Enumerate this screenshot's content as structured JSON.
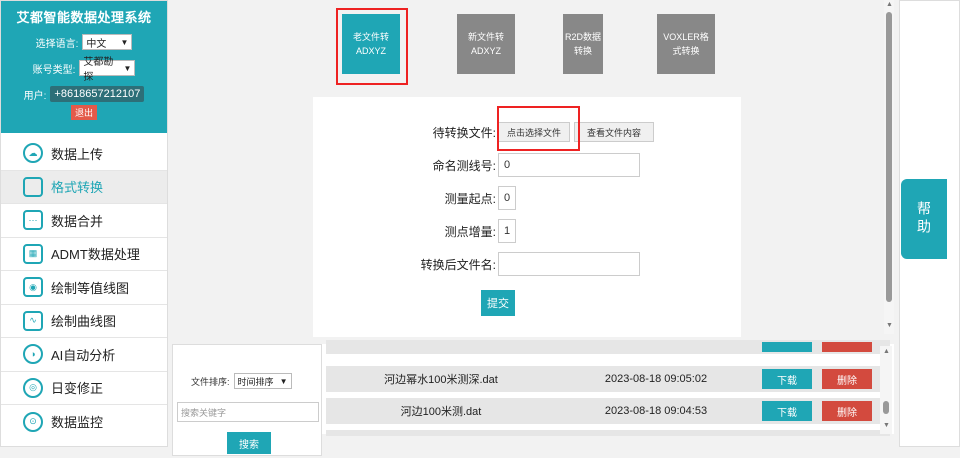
{
  "app_title": "艾都智能数据处理系统",
  "language": {
    "label": "选择语言:",
    "value": "中文"
  },
  "account_type": {
    "label": "账号类型:",
    "value": "艾都勘探"
  },
  "user": {
    "label": "用户:",
    "phone": "+8618657212107",
    "logout": "退出"
  },
  "nav": [
    {
      "label": "数据上传",
      "icon": "cloud-upload-icon"
    },
    {
      "label": "格式转换",
      "icon": "convert-icon"
    },
    {
      "label": "数据合并",
      "icon": "merge-icon"
    },
    {
      "label": "ADMT数据处理",
      "icon": "process-icon"
    },
    {
      "label": "绘制等值线图",
      "icon": "contour-icon"
    },
    {
      "label": "绘制曲线图",
      "icon": "curve-icon"
    },
    {
      "label": "AI自动分析",
      "icon": "ai-icon"
    },
    {
      "label": "日变修正",
      "icon": "correction-icon"
    },
    {
      "label": "数据监控",
      "icon": "monitor-icon"
    }
  ],
  "tools": [
    {
      "label": "老文件转ADXYZ"
    },
    {
      "label": "新文件转ADXYZ"
    },
    {
      "label": "R2D数据转换"
    },
    {
      "label": "VOXLER格式转换"
    }
  ],
  "form": {
    "file_label": "待转换文件:",
    "select_file_btn": "点击选择文件",
    "view_file_btn": "查看文件内容",
    "line_label": "命名测线号:",
    "line_value": "0",
    "start_label": "测量起点:",
    "start_value": "0",
    "step_label": "测点增量:",
    "step_value": "1",
    "outname_label": "转换后文件名:",
    "outname_value": "",
    "submit": "提交"
  },
  "file_panel": {
    "sort_label": "文件排序:",
    "sort_value": "时间排序",
    "search_placeholder": "搜索关键字",
    "search_btn": "搜索"
  },
  "files": [
    {
      "name": "河边幂水100米测深.dat",
      "time": "2023-08-18 09:05:02"
    },
    {
      "name": "河边100米测.dat",
      "time": "2023-08-18 09:04:53"
    }
  ],
  "file_actions": {
    "download": "下载",
    "delete": "删除"
  },
  "help": "帮助"
}
